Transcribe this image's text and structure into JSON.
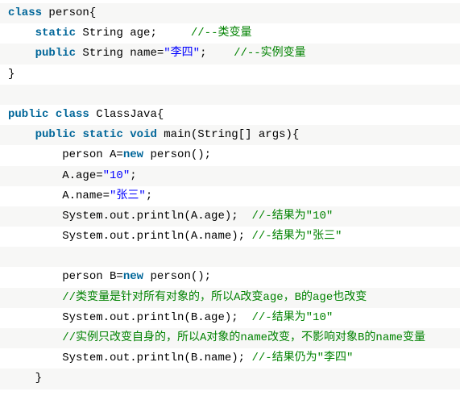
{
  "lines": [
    {
      "alt": true,
      "segments": [
        {
          "cls": "kw",
          "t": "class"
        },
        {
          "cls": "pln",
          "t": " person{"
        }
      ]
    },
    {
      "alt": false,
      "segments": [
        {
          "cls": "pln",
          "t": "    "
        },
        {
          "cls": "kw",
          "t": "static"
        },
        {
          "cls": "pln",
          "t": " String age;     "
        },
        {
          "cls": "cmt",
          "t": "//--类变量"
        }
      ]
    },
    {
      "alt": true,
      "segments": [
        {
          "cls": "pln",
          "t": "    "
        },
        {
          "cls": "kw",
          "t": "public"
        },
        {
          "cls": "pln",
          "t": " String name="
        },
        {
          "cls": "str",
          "t": "\"李四\""
        },
        {
          "cls": "pln",
          "t": ";    "
        },
        {
          "cls": "cmt",
          "t": "//--实例变量"
        }
      ]
    },
    {
      "alt": false,
      "segments": [
        {
          "cls": "pln",
          "t": "}"
        }
      ]
    },
    {
      "alt": true,
      "segments": [
        {
          "cls": "pln",
          "t": " "
        }
      ]
    },
    {
      "alt": false,
      "segments": [
        {
          "cls": "kw",
          "t": "public"
        },
        {
          "cls": "pln",
          "t": " "
        },
        {
          "cls": "kw",
          "t": "class"
        },
        {
          "cls": "pln",
          "t": " ClassJava{"
        }
      ]
    },
    {
      "alt": true,
      "segments": [
        {
          "cls": "pln",
          "t": "    "
        },
        {
          "cls": "kw",
          "t": "public"
        },
        {
          "cls": "pln",
          "t": " "
        },
        {
          "cls": "kw",
          "t": "static"
        },
        {
          "cls": "pln",
          "t": " "
        },
        {
          "cls": "kw",
          "t": "void"
        },
        {
          "cls": "pln",
          "t": " main(String[] args){"
        }
      ]
    },
    {
      "alt": false,
      "segments": [
        {
          "cls": "pln",
          "t": "        person A="
        },
        {
          "cls": "kw",
          "t": "new"
        },
        {
          "cls": "pln",
          "t": " person();"
        }
      ]
    },
    {
      "alt": true,
      "segments": [
        {
          "cls": "pln",
          "t": "        A.age="
        },
        {
          "cls": "str",
          "t": "\"10\""
        },
        {
          "cls": "pln",
          "t": ";"
        }
      ]
    },
    {
      "alt": false,
      "segments": [
        {
          "cls": "pln",
          "t": "        A.name="
        },
        {
          "cls": "str",
          "t": "\"张三\""
        },
        {
          "cls": "pln",
          "t": ";"
        }
      ]
    },
    {
      "alt": true,
      "segments": [
        {
          "cls": "pln",
          "t": "        System.out.println(A.age);  "
        },
        {
          "cls": "cmt",
          "t": "//-结果为\"10\""
        }
      ]
    },
    {
      "alt": false,
      "segments": [
        {
          "cls": "pln",
          "t": "        System.out.println(A.name); "
        },
        {
          "cls": "cmt",
          "t": "//-结果为\"张三\""
        }
      ]
    },
    {
      "alt": true,
      "segments": [
        {
          "cls": "pln",
          "t": " "
        }
      ]
    },
    {
      "alt": false,
      "segments": [
        {
          "cls": "pln",
          "t": "        person B="
        },
        {
          "cls": "kw",
          "t": "new"
        },
        {
          "cls": "pln",
          "t": " person();"
        }
      ]
    },
    {
      "alt": true,
      "segments": [
        {
          "cls": "pln",
          "t": "        "
        },
        {
          "cls": "cmt",
          "t": "//类变量是针对所有对象的，所以A改变age，B的age也改变"
        }
      ]
    },
    {
      "alt": false,
      "segments": [
        {
          "cls": "pln",
          "t": "        System.out.println(B.age);  "
        },
        {
          "cls": "cmt",
          "t": "//-结果为\"10\""
        }
      ]
    },
    {
      "alt": true,
      "segments": [
        {
          "cls": "pln",
          "t": "        "
        },
        {
          "cls": "cmt",
          "t": "//实例只改变自身的，所以A对象的name改变，不影响对象B的name变量"
        }
      ]
    },
    {
      "alt": false,
      "segments": [
        {
          "cls": "pln",
          "t": "        System.out.println(B.name); "
        },
        {
          "cls": "cmt",
          "t": "//-结果仍为\"李四\""
        }
      ]
    },
    {
      "alt": true,
      "segments": [
        {
          "cls": "pln",
          "t": "    }"
        }
      ]
    }
  ]
}
